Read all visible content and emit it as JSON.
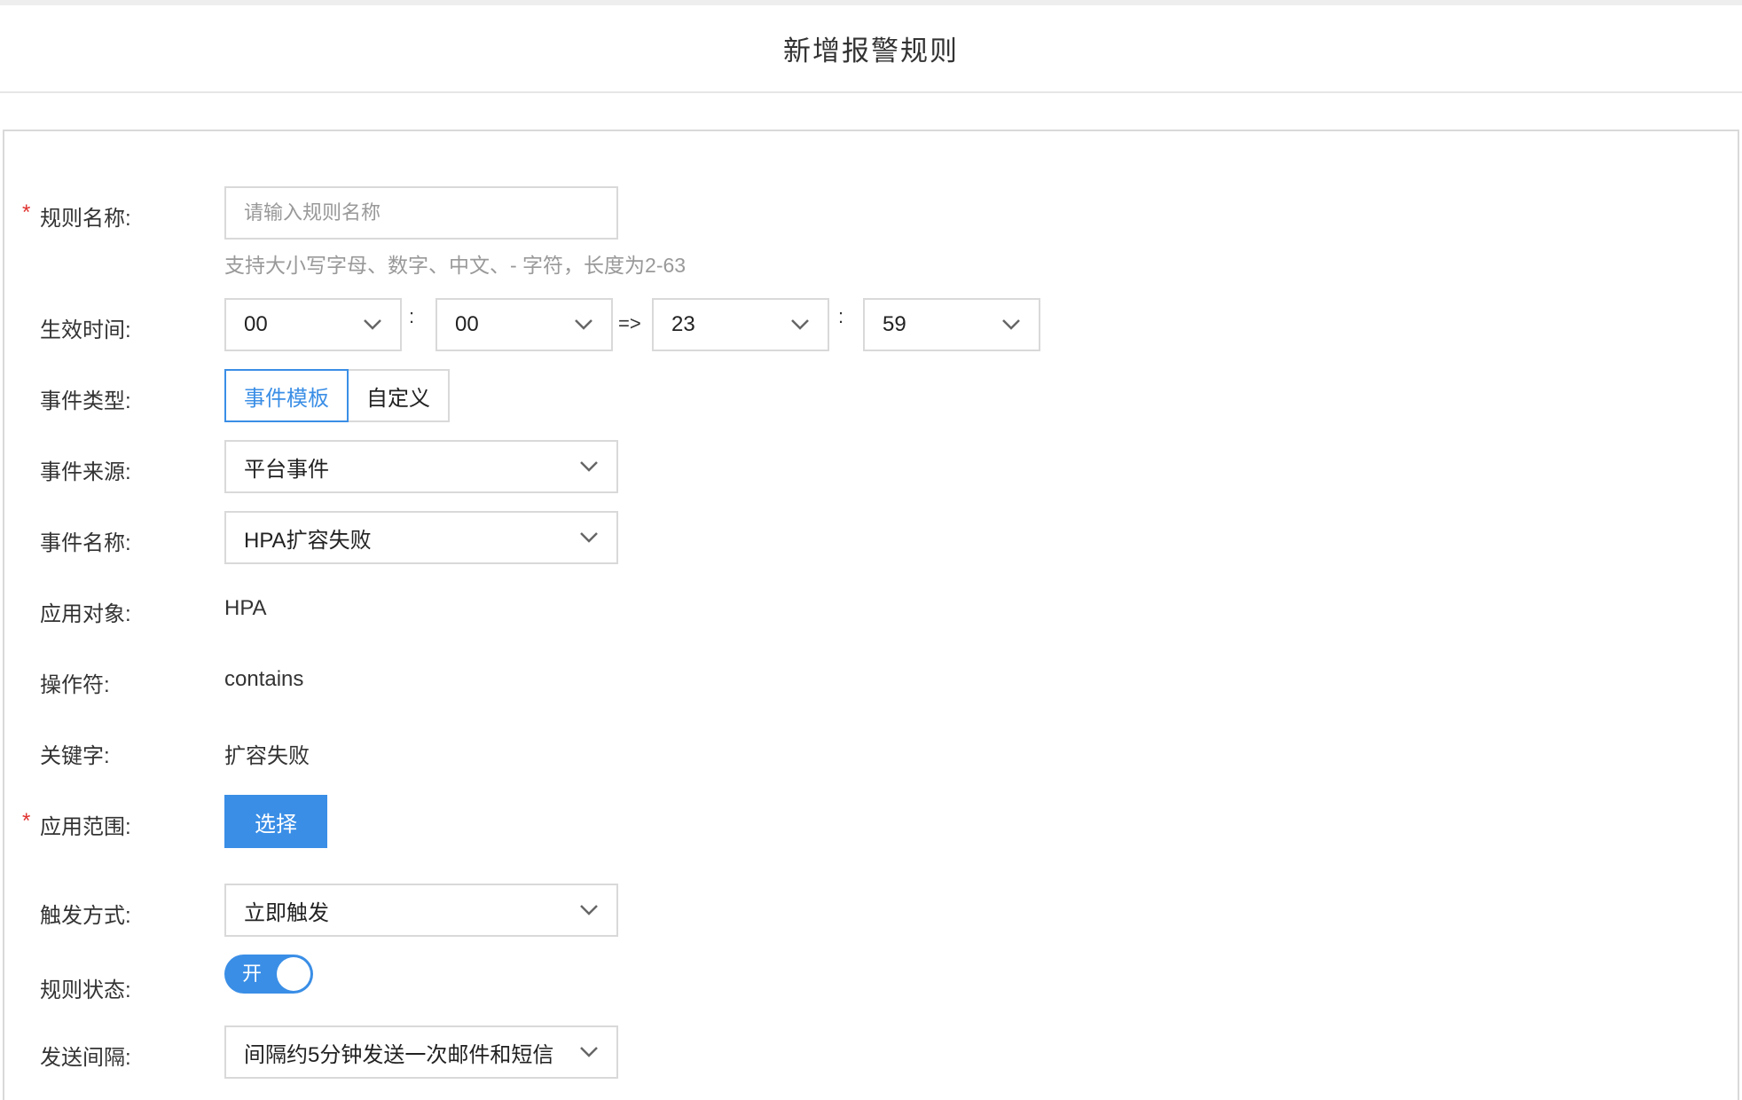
{
  "header": {
    "title": "新增报警规则"
  },
  "form": {
    "rule_name": {
      "label": "规则名称:",
      "required_mark": "*",
      "placeholder": "请输入规则名称",
      "hint": "支持大小写字母、数字、中文、- 字符，长度为2-63"
    },
    "effective_time": {
      "label": "生效时间:",
      "start_hour": "00",
      "start_minute": "00",
      "end_hour": "23",
      "end_minute": "59",
      "colon": ":",
      "arrow": "=>"
    },
    "event_type": {
      "label": "事件类型:",
      "options": [
        "事件模板",
        "自定义"
      ],
      "selected": "事件模板"
    },
    "event_source": {
      "label": "事件来源:",
      "value": "平台事件"
    },
    "event_name": {
      "label": "事件名称:",
      "value": "HPA扩容失败"
    },
    "target": {
      "label": "应用对象:",
      "value": "HPA"
    },
    "operator": {
      "label": "操作符:",
      "value": "contains"
    },
    "keyword": {
      "label": "关键字:",
      "value": "扩容失败"
    },
    "scope": {
      "label": "应用范围:",
      "required_mark": "*",
      "button": "选择"
    },
    "trigger": {
      "label": "触发方式:",
      "value": "立即触发"
    },
    "status": {
      "label": "规则状态:",
      "toggle_text": "开",
      "on": true
    },
    "interval": {
      "label": "发送间隔:",
      "value": "间隔约5分钟发送一次邮件和短信"
    }
  },
  "colors": {
    "accent": "#3a8ee6",
    "required": "#e0322f",
    "border": "#d9d9d9"
  }
}
